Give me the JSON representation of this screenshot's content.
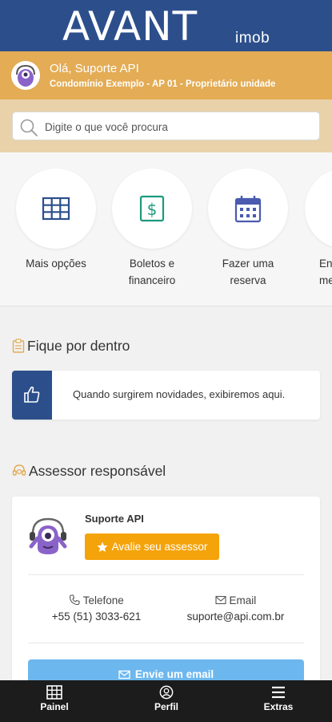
{
  "header": {
    "brand": "AVANT",
    "brand_sub": "imob"
  },
  "user": {
    "greeting": "Olá, Suporte API",
    "details": "Condomínio Exemplo - AP 01 - Proprietário unidade"
  },
  "search": {
    "placeholder": "Digite o que você procura"
  },
  "shortcuts": [
    {
      "label": "Mais opções",
      "icon": "grid-icon"
    },
    {
      "label": "Boletos e financeiro",
      "icon": "dollar-icon"
    },
    {
      "label": "Fazer uma reserva",
      "icon": "calendar-icon"
    },
    {
      "label": "En me",
      "icon": "doc-icon"
    }
  ],
  "news": {
    "title": "Fique por dentro",
    "empty_text": "Quando surgirem novidades, exibiremos aqui."
  },
  "advisor": {
    "title": "Assessor responsável",
    "name": "Suporte API",
    "rate_label": "Avalie seu assessor",
    "phone_label": "Telefone",
    "phone": "+55 (51) 3033-621",
    "email_label": "Email",
    "email": "suporte@api.com.br",
    "send_email_label": "Envie um email"
  },
  "bottom_nav": [
    {
      "label": "Painel",
      "icon": "grid-icon"
    },
    {
      "label": "Perfil",
      "icon": "user-icon"
    },
    {
      "label": "Extras",
      "icon": "menu-icon"
    }
  ],
  "colors": {
    "primary": "#2c4f8c",
    "accent": "#e3ac55",
    "rate": "#f5a30a",
    "email_button": "#6db7ef",
    "nav_bg": "#1c1c1c"
  }
}
